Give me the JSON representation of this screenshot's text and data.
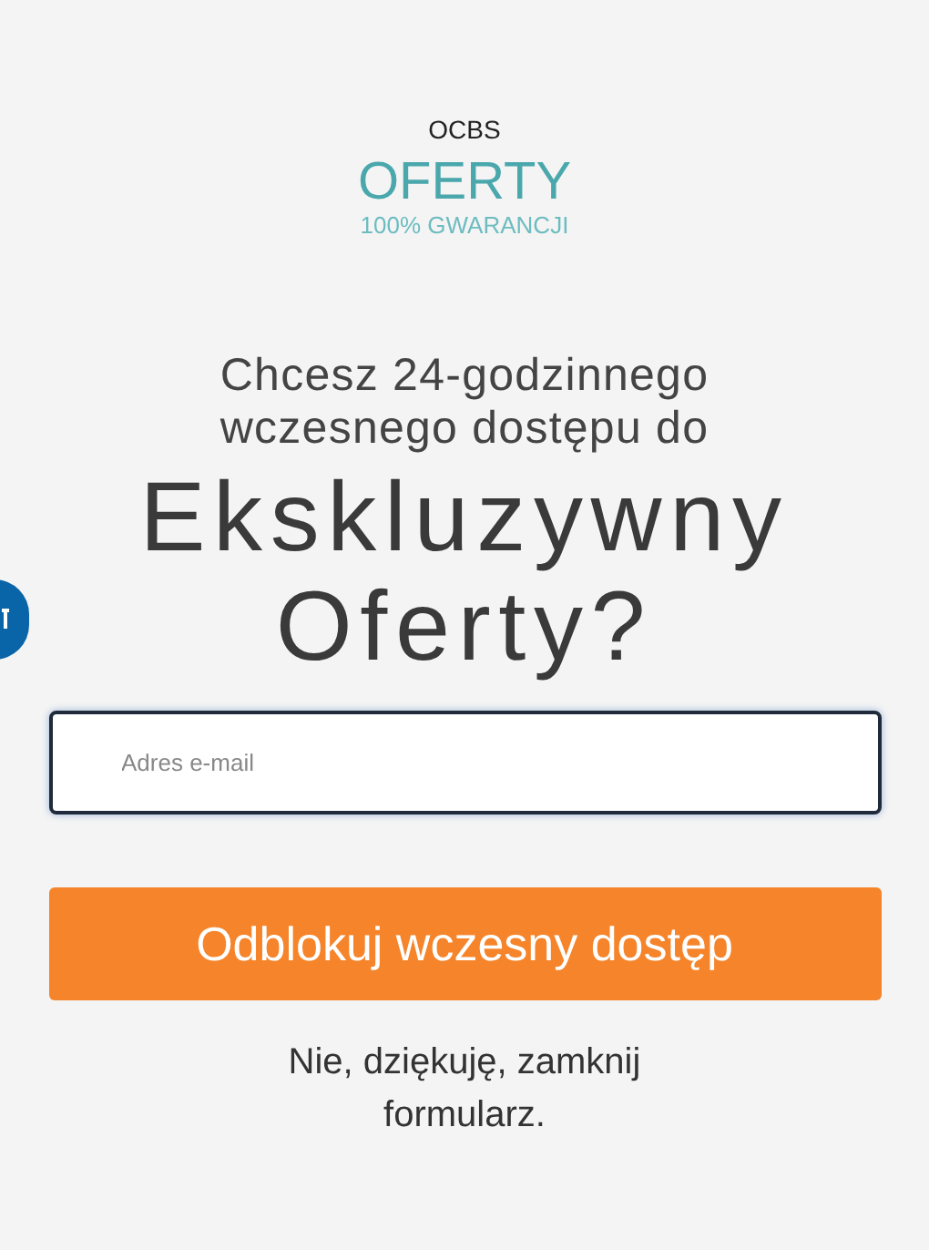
{
  "brand": {
    "name": "OCBS",
    "title": "OFERTY",
    "subtitle": "100% GWARANCJI"
  },
  "heading": {
    "line_1": "Chcesz 24-godzinnego wczesnego dostępu do",
    "line_2": "Ekskluzywny Oferty?"
  },
  "email_field": {
    "placeholder": "Adres e-mail"
  },
  "submit_button": {
    "label": "Odblokuj wczesny dostęp"
  },
  "dismiss_link": {
    "label": "Nie, dziękuję, zamknij formularz."
  }
}
